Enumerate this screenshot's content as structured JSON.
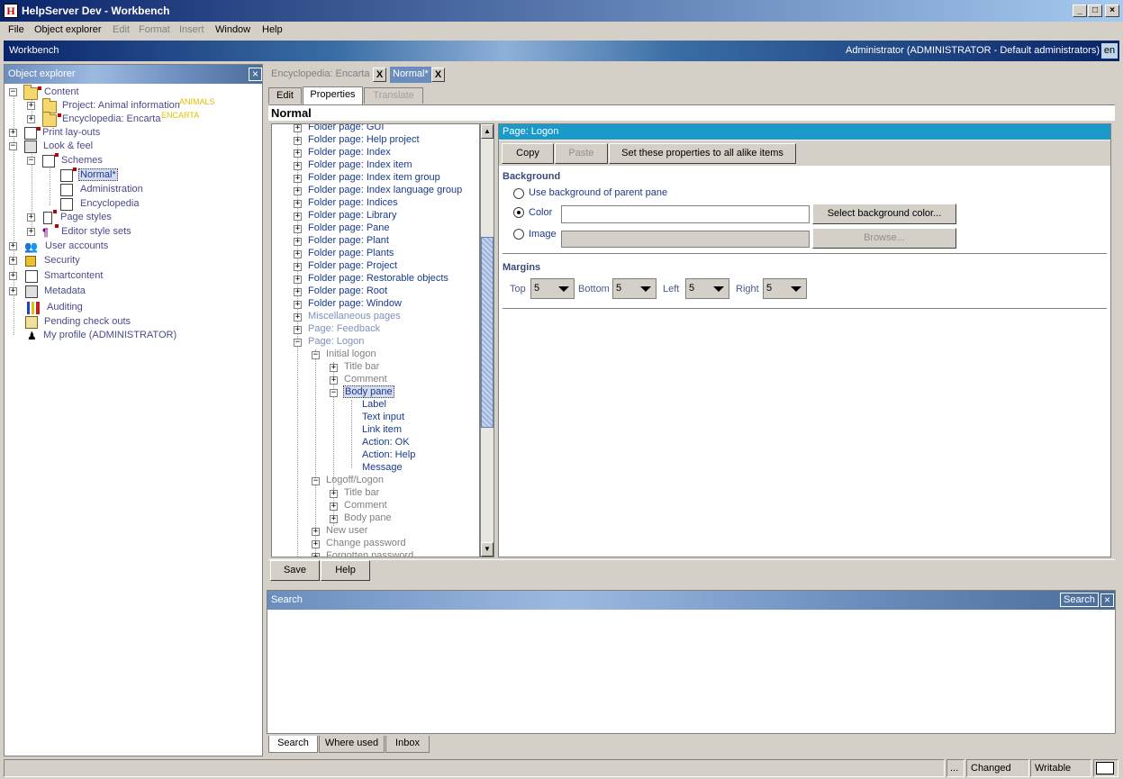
{
  "window": {
    "title": "HelpServer Dev - Workbench",
    "icon": "H"
  },
  "menu": [
    {
      "label": "File",
      "enabled": true
    },
    {
      "label": "Object explorer",
      "enabled": true
    },
    {
      "label": "Edit",
      "enabled": false
    },
    {
      "label": "Format",
      "enabled": false
    },
    {
      "label": "Insert",
      "enabled": false
    },
    {
      "label": "Window",
      "enabled": true
    },
    {
      "label": "Help",
      "enabled": true
    }
  ],
  "header": {
    "title": "Workbench",
    "user": "Administrator (ADMINISTRATOR - Default administrators)",
    "lang": "en"
  },
  "explorer": {
    "title": "Object explorer",
    "items": [
      {
        "label": "Content"
      },
      {
        "label": "Project: Animal information",
        "tag": "ANIMALS"
      },
      {
        "label": "Encyclopedia: Encarta",
        "tag": "ENCARTA"
      },
      {
        "label": "Print lay-outs"
      },
      {
        "label": "Look & feel"
      },
      {
        "label": "Schemes"
      },
      {
        "label": "Normal*"
      },
      {
        "label": "Administration"
      },
      {
        "label": "Encyclopedia"
      },
      {
        "label": "Page styles"
      },
      {
        "label": "Editor style sets"
      },
      {
        "label": "User accounts"
      },
      {
        "label": "Security"
      },
      {
        "label": "Smartcontent"
      },
      {
        "label": "Metadata"
      },
      {
        "label": "Auditing"
      },
      {
        "label": "Pending check outs"
      },
      {
        "label": "My profile (ADMINISTRATOR)"
      }
    ]
  },
  "doctabs": [
    {
      "label": "Encyclopedia: Encarta",
      "active": false
    },
    {
      "label": "Normal*",
      "active": true
    }
  ],
  "subtabs": [
    {
      "label": "Edit",
      "enabled": true
    },
    {
      "label": "Properties",
      "enabled": true,
      "active": true
    },
    {
      "label": "Translate",
      "enabled": false
    }
  ],
  "main_title": "Normal",
  "tree": [
    "Folder page: GUI",
    "Folder page: Help project",
    "Folder page: Index",
    "Folder page: Index item",
    "Folder page: Index item group",
    "Folder page: Index language group",
    "Folder page: Indices",
    "Folder page: Library",
    "Folder page: Pane",
    "Folder page: Plant",
    "Folder page: Plants",
    "Folder page: Project",
    "Folder page: Restorable objects",
    "Folder page: Root",
    "Folder page: Window",
    "Miscellaneous pages",
    "Page: Feedback",
    "Page: Logon",
    "Initial logon",
    "Title bar",
    "Comment",
    "Body pane",
    "Label",
    "Text input",
    "Link item",
    "Action: OK",
    "Action: Help",
    "Message",
    "Logoff/Logon",
    "Title bar",
    "Comment",
    "Body pane",
    "New user",
    "Change password",
    "Forgotten password"
  ],
  "props": {
    "header": "Page: Logon",
    "copy": "Copy",
    "paste": "Paste",
    "set_all": "Set these properties to all alike items",
    "background_title": "Background",
    "opt_parent": "Use background of parent pane",
    "opt_color": "Color",
    "opt_image": "Image",
    "selected_option": "Color",
    "color_value": "",
    "image_value": "",
    "select_color_btn": "Select background color...",
    "browse_btn": "Browse...",
    "margins_title": "Margins",
    "margins": [
      {
        "label": "Top",
        "value": "5"
      },
      {
        "label": "Bottom",
        "value": "5"
      },
      {
        "label": "Left",
        "value": "5"
      },
      {
        "label": "Right",
        "value": "5"
      }
    ]
  },
  "buttons": {
    "save": "Save",
    "help": "Help"
  },
  "search": {
    "title": "Search",
    "button": "Search"
  },
  "bottom_tabs": [
    "Search",
    "Where used",
    "Inbox"
  ],
  "status": {
    "dots": "...",
    "changed": "Changed",
    "writable": "Writable"
  },
  "colors": {
    "accent": "#1b9ac9",
    "title_start": "#0a246a"
  }
}
